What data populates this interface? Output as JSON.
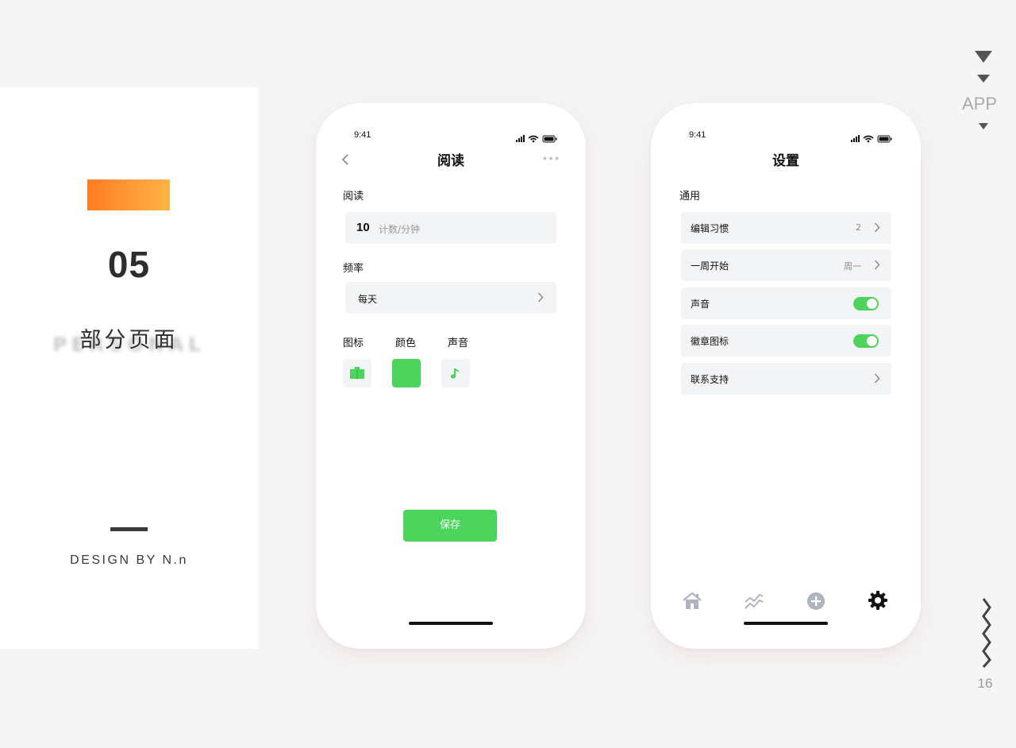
{
  "left_panel": {
    "section_number": "05",
    "section_title": "部分页面",
    "ghost_text": "PERSONAL",
    "designer_credit": "DESIGN BY N.n",
    "accent_gradient": [
      "#ff7d22",
      "#ffb347"
    ]
  },
  "side_deco": {
    "category_label": "APP",
    "page_number": "16"
  },
  "phone_reading": {
    "status_time": "9:41",
    "nav_title": "阅读",
    "reading_label": "阅读",
    "count_value": "10",
    "count_unit": "计数/分钟",
    "frequency_label": "频率",
    "frequency_value": "每天",
    "icon_label": "图标",
    "color_label": "颜色",
    "sound_label": "声音",
    "selected_icon": "book-icon",
    "selected_color": "#4cd45c",
    "selected_sound": "music-note-icon",
    "save_label": "保存"
  },
  "phone_settings": {
    "status_time": "9:41",
    "nav_title": "设置",
    "section_label": "通用",
    "rows": [
      {
        "label": "编辑习惯",
        "value": "2",
        "control": "chevron"
      },
      {
        "label": "一周开始",
        "value": "周一",
        "control": "chevron"
      },
      {
        "label": "声音",
        "control": "toggle",
        "on": true
      },
      {
        "label": "徽章图标",
        "control": "toggle",
        "on": true
      },
      {
        "label": "联系支持",
        "control": "chevron"
      }
    ],
    "tabs": [
      {
        "icon": "home-icon",
        "active": false
      },
      {
        "icon": "stats-icon",
        "active": false
      },
      {
        "icon": "add-icon",
        "active": false
      },
      {
        "icon": "gear-icon",
        "active": true
      }
    ]
  },
  "colors": {
    "accent_green": "#4cd45c",
    "field_bg": "#f3f4f6",
    "background": "#f5f5f5"
  }
}
